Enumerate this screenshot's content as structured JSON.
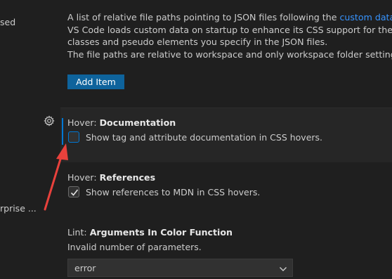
{
  "sidebar": {
    "fragment_top": "sed",
    "fragment_mid": "rprise ..."
  },
  "custom_data": {
    "description_line1_prefix": "A list of relative file paths pointing to JSON files following the ",
    "description_line1_link": "custom data forma",
    "description_line2": "VS Code loads custom data on startup to enhance its CSS support for the custom",
    "description_line3": "classes and pseudo elements you specify in the JSON files.",
    "description_line4": "The file paths are relative to workspace and only workspace folder settings are co",
    "add_item_label": "Add Item"
  },
  "hover_documentation": {
    "category": "Hover: ",
    "name": "Documentation",
    "checkbox_label": "Show tag and attribute documentation in CSS hovers.",
    "checked": false
  },
  "hover_references": {
    "category": "Hover: ",
    "name": "References",
    "checkbox_label": "Show references to MDN in CSS hovers.",
    "checked": true
  },
  "lint_arguments": {
    "category": "Lint: ",
    "name": "Arguments In Color Function",
    "description": "Invalid number of parameters.",
    "selected_value": "error"
  },
  "colors": {
    "accent": "#0078d4",
    "button": "#0e639c",
    "link": "#3794ff",
    "annotation_arrow": "#e8413c"
  }
}
